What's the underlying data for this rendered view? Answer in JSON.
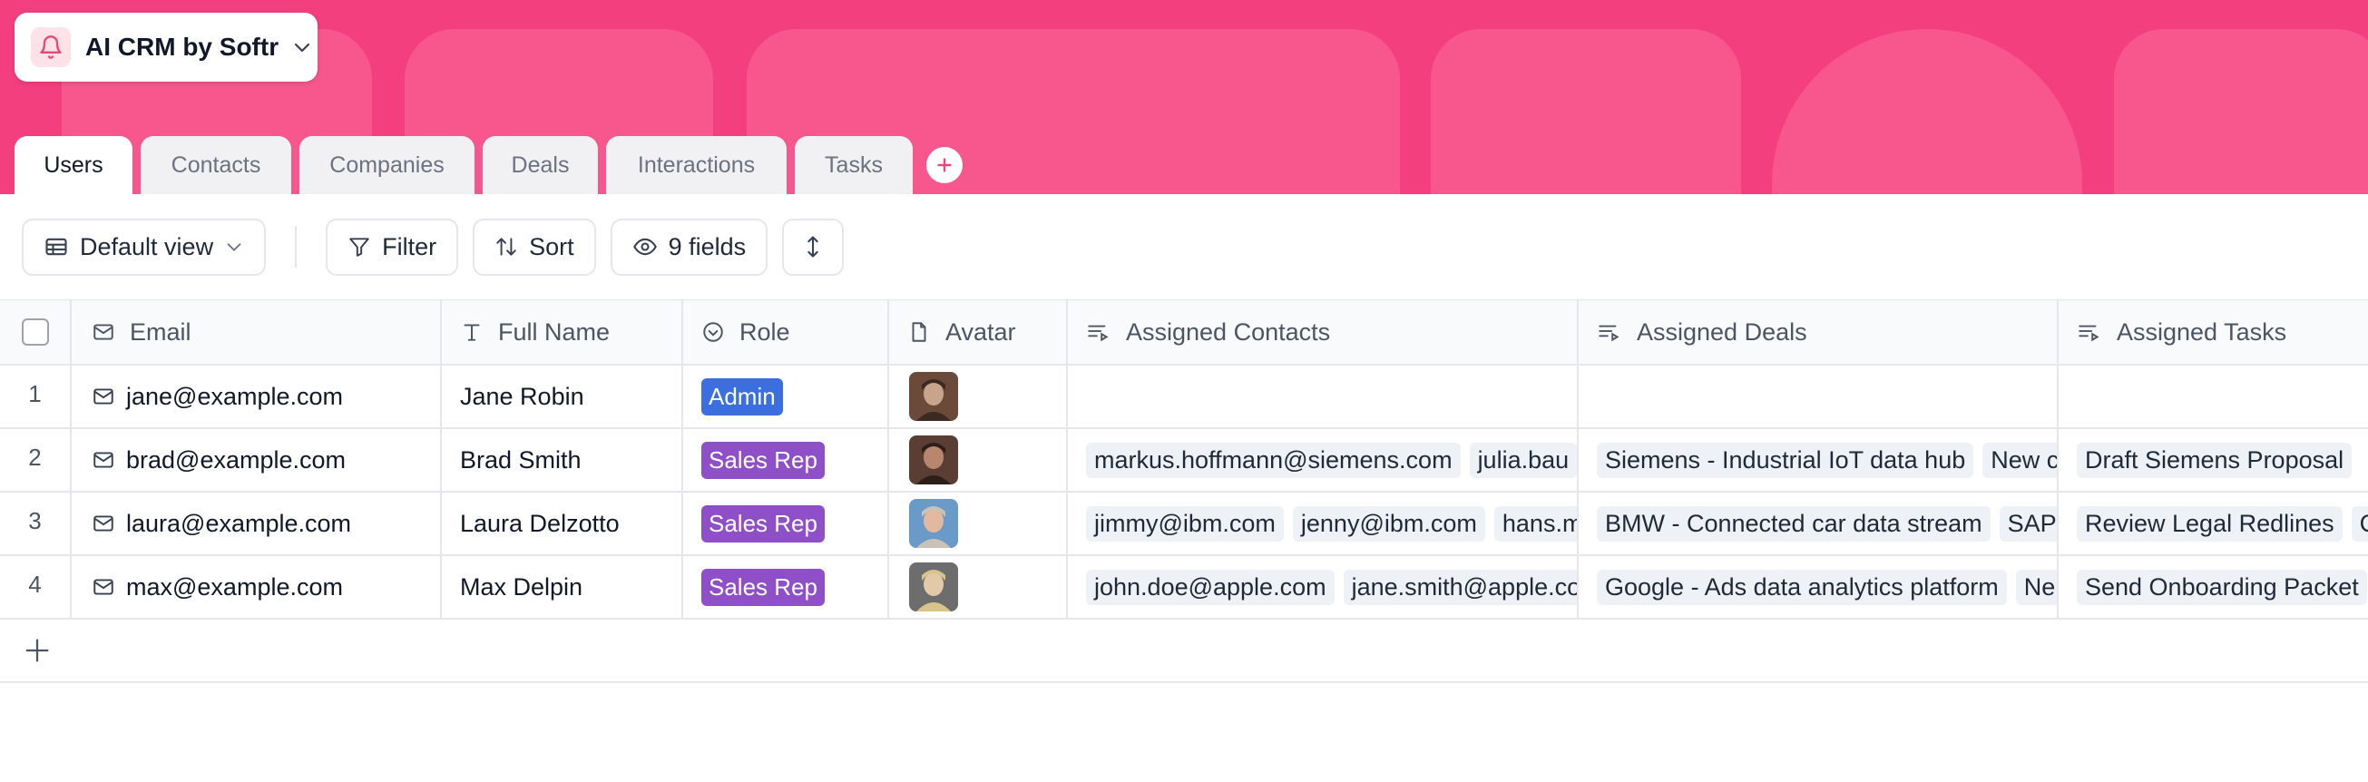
{
  "base": {
    "name": "AI CRM by Softr",
    "logo_icon": "bell-icon"
  },
  "tabs": [
    {
      "label": "Users",
      "active": true
    },
    {
      "label": "Contacts",
      "active": false
    },
    {
      "label": "Companies",
      "active": false
    },
    {
      "label": "Deals",
      "active": false
    },
    {
      "label": "Interactions",
      "active": false
    },
    {
      "label": "Tasks",
      "active": false
    }
  ],
  "toolbar": {
    "view_label": "Default view",
    "filter_label": "Filter",
    "sort_label": "Sort",
    "fields_label": "9 fields"
  },
  "columns": [
    {
      "label": "Email",
      "icon": "mail-icon"
    },
    {
      "label": "Full Name",
      "icon": "text-icon"
    },
    {
      "label": "Role",
      "icon": "select-icon"
    },
    {
      "label": "Avatar",
      "icon": "file-icon"
    },
    {
      "label": "Assigned Contacts",
      "icon": "linked-record-icon"
    },
    {
      "label": "Assigned Deals",
      "icon": "linked-record-icon"
    },
    {
      "label": "Assigned Tasks",
      "icon": "linked-record-icon"
    }
  ],
  "rows": [
    {
      "num": "1",
      "email": "jane@example.com",
      "name": "Jane Robin",
      "role": "Admin",
      "role_color": "#3b6fe0",
      "contacts": [],
      "deals": [],
      "tasks": []
    },
    {
      "num": "2",
      "email": "brad@example.com",
      "name": "Brad Smith",
      "role": "Sales Rep",
      "role_color": "#8e4fc9",
      "contacts": [
        "markus.hoffmann@siemens.com",
        "julia.bau"
      ],
      "deals": [
        "Siemens - Industrial IoT data hub",
        "New c"
      ],
      "tasks": [
        "Draft Siemens Proposal"
      ]
    },
    {
      "num": "3",
      "email": "laura@example.com",
      "name": "Laura Delzotto",
      "role": "Sales Rep",
      "role_color": "#8e4fc9",
      "contacts": [
        "jimmy@ibm.com",
        "jenny@ibm.com",
        "hans.m"
      ],
      "deals": [
        "BMW - Connected car data stream",
        "SAP"
      ],
      "tasks": [
        "Review Legal Redlines",
        "C"
      ]
    },
    {
      "num": "4",
      "email": "max@example.com",
      "name": "Max Delpin",
      "role": "Sales Rep",
      "role_color": "#8e4fc9",
      "contacts": [
        "john.doe@apple.com",
        "jane.smith@apple.co"
      ],
      "deals": [
        "Google - Ads data analytics platform",
        "Ne"
      ],
      "tasks": [
        "Send Onboarding Packet"
      ]
    }
  ],
  "colors": {
    "banner": "#f43f7f",
    "banner_shape": "#f7578d",
    "admin": "#3b6fe0",
    "sales_rep": "#8e4fc9"
  }
}
